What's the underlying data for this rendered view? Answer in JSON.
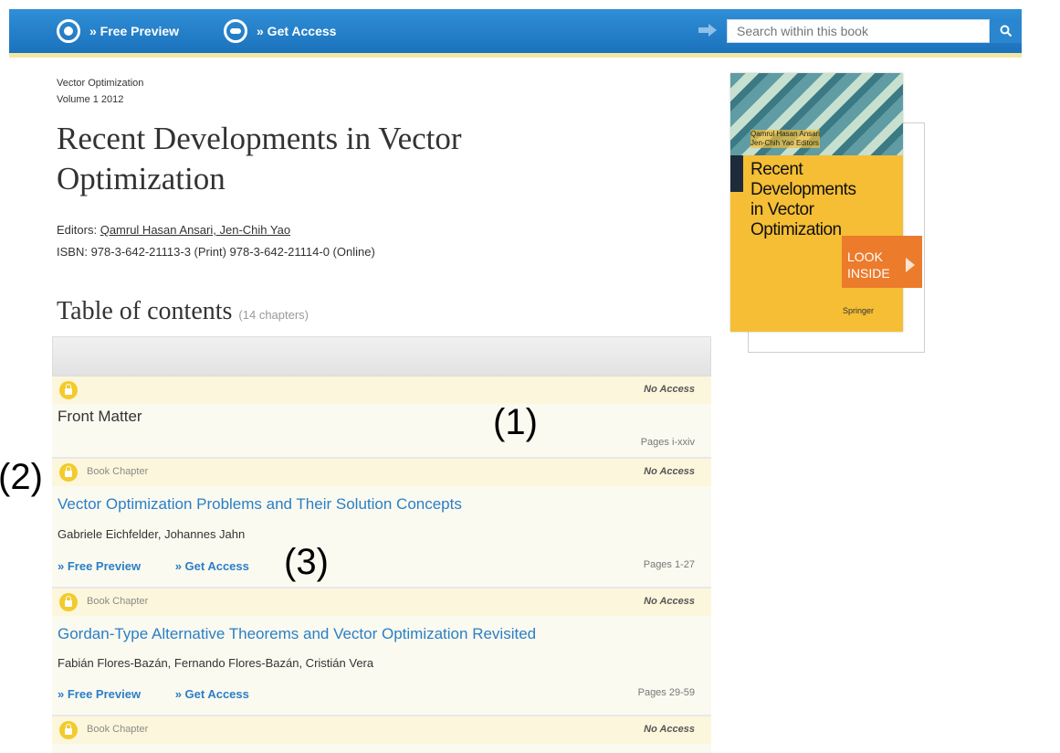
{
  "topbar": {
    "free_preview": "» Free Preview",
    "get_access": "» Get Access",
    "search_placeholder": "Search within this book"
  },
  "book": {
    "series": "Vector Optimization",
    "volume": "Volume 1 2012",
    "title": "Recent Developments in Vector Optimization",
    "editors_label": "Editors:",
    "editors": "Qamrul Hasan Ansari, Jen-Chih Yao",
    "isbn": "ISBN: 978-3-642-21113-3 (Print) 978-3-642-21114-0 (Online)"
  },
  "cover": {
    "editors": "Qamrul Hasan Ansari\nJen-Chih Yao Editors",
    "title": "Recent\nDevelopments\nin Vector\nOptimization",
    "publisher": "Springer",
    "look_inside": "LOOK\nINSIDE"
  },
  "toc": {
    "heading": "Table of contents",
    "count": "(14 chapters)",
    "entries": [
      {
        "type": "",
        "access": "No Access",
        "title": "Front Matter",
        "authors": "",
        "pages": "Pages i-xxiv"
      },
      {
        "type": "Book Chapter",
        "access": "No Access",
        "title": "Vector Optimization Problems and Their Solution Concepts",
        "authors": "Gabriele Eichfelder, Johannes Jahn",
        "free_preview": "» Free Preview",
        "get_access": "» Get Access",
        "pages": "Pages 1-27"
      },
      {
        "type": "Book Chapter",
        "access": "No Access",
        "title": "Gordan-Type Alternative Theorems and Vector Optimization Revisited",
        "authors": "Fabián Flores-Bazán, Fernando Flores-Bazán, Cristián Vera",
        "free_preview": "» Free Preview",
        "get_access": "» Get Access",
        "pages": "Pages 29-59"
      },
      {
        "type": "Book Chapter",
        "access": "No Access"
      }
    ]
  },
  "annotations": [
    "(1)",
    "(2)",
    "(3)"
  ]
}
